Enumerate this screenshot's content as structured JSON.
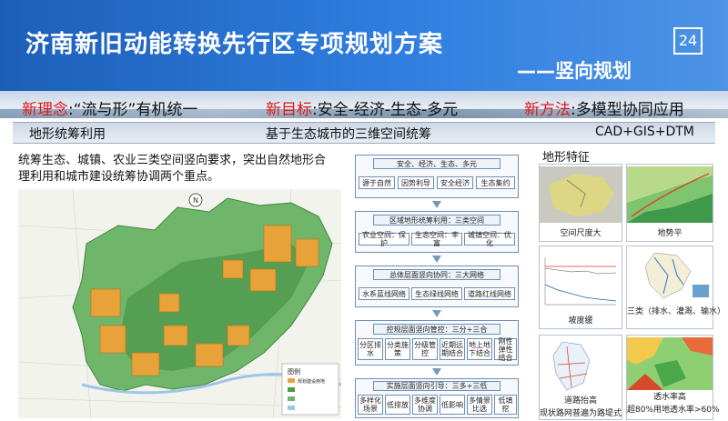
{
  "header": {
    "title": "济南新旧动能转换先行区专项规划方案",
    "subtitle": "——竖向规划",
    "page_number": "24"
  },
  "slogans": [
    {
      "label": "新理念",
      "text": ":“流与形”有机统一"
    },
    {
      "label": "新目标",
      "text": ":安全-经济-生态-多元"
    },
    {
      "label": "新方法",
      "text": ":多模型协同应用"
    }
  ],
  "section_bar": {
    "left": "地形统筹利用",
    "center": "基于生态城市的三维空间统筹",
    "right": "CAD+GIS+DTM"
  },
  "description": "统筹生态、城镇、农业三类空间竖向要求，突出自然地形合理利用和城市建设统筹协调两个重点。",
  "map": {
    "north_label": "N",
    "legend_title": "图例",
    "legend_items": [
      "规划建设用地",
      "",
      ""
    ]
  },
  "flow": {
    "top": {
      "head": "安全、经济、生态、多元",
      "items": [
        "源于自然",
        "因势利导",
        "安全经济",
        "生态集约"
      ]
    },
    "level1": {
      "head": "区域地形统筹利用：三类空间",
      "items": [
        "农业空间：保护",
        "生态空间：丰富",
        "城镇空间：优化"
      ]
    },
    "level2": {
      "head": "总体层面竖向协同：三大网络",
      "items": [
        "水系蓝线网络",
        "生态绿线网络",
        "道路红线网络"
      ]
    },
    "level3": {
      "head": "控规层面竖向管控：三分+三合",
      "items": [
        "分区排水",
        "分类施策",
        "分级管控",
        "近期远期结合",
        "地上地下结合",
        "刚性弹性结合"
      ]
    },
    "level4": {
      "head": "实施层面竖向引导：三多+三低",
      "items": [
        "多样化场景",
        "低排放",
        "多维度协调",
        "低影响",
        "多情景比选",
        "低填挖"
      ]
    }
  },
  "features": {
    "title": "地形特征",
    "captions": [
      "空间尺度大",
      "地势平",
      "坡度缓",
      "三类（排水、灌溉、输水）",
      "道路抬高",
      "现状路网普遍为路堤式",
      "透水率高",
      "超80%用地透水率>60%"
    ]
  },
  "colors": {
    "header": "#2a74d4",
    "accent_red": "#e01818",
    "green": "#5daa55",
    "orange": "#e88a2a"
  }
}
